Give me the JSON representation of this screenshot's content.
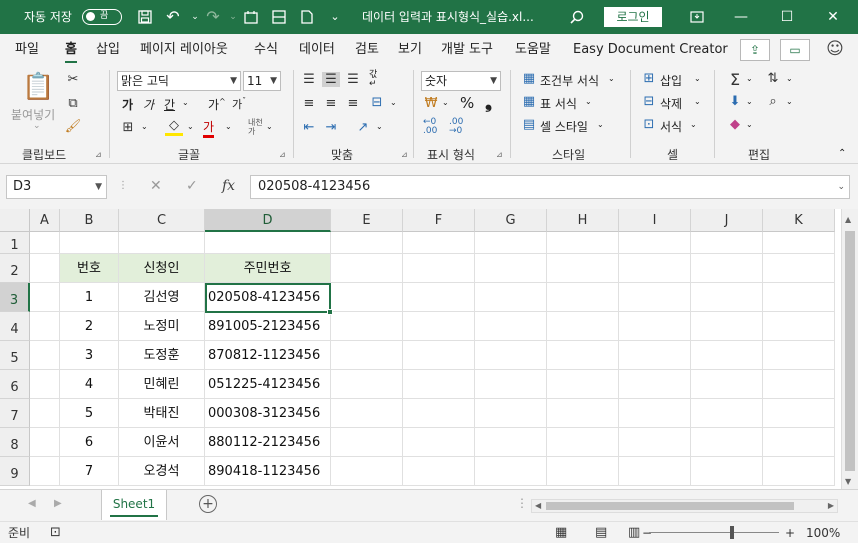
{
  "titlebar": {
    "autosave_label": "자동 저장",
    "autosave_state": "끔",
    "filename": "데이터 입력과 표시형식_실습.xl...",
    "login_label": "로그인"
  },
  "tabs": [
    "파일",
    "홈",
    "삽입",
    "페이지 레이아웃",
    "수식",
    "데이터",
    "검토",
    "보기",
    "개발 도구",
    "도움말",
    "Easy Document Creator"
  ],
  "ribbon": {
    "paste_label": "붙여넣기",
    "clipboard_label": "클립보드",
    "font_name": "맑은 고딕",
    "font_size": "11",
    "font_group_label": "글꼴",
    "align_group_label": "맞춤",
    "number_format": "숫자",
    "number_group_label": "표시 형식",
    "cond_format_label": "조건부 서식",
    "table_format_label": "표 서식",
    "cell_style_label": "셀 스타일",
    "style_group_label": "스타일",
    "insert_label": "삽입",
    "delete_label": "삭제",
    "format_label": "서식",
    "cells_group_label": "셀",
    "edit_group_label": "편집"
  },
  "formula_bar": {
    "name_box": "D3",
    "formula": "020508-4123456"
  },
  "grid": {
    "columns": [
      "A",
      "B",
      "C",
      "D",
      "E",
      "F",
      "G",
      "H",
      "I",
      "J",
      "K"
    ],
    "rows": [
      "1",
      "2",
      "3",
      "4",
      "5",
      "6",
      "7",
      "8",
      "9"
    ],
    "table_headers": [
      "번호",
      "신청인",
      "주민번호"
    ],
    "table_rows": [
      [
        "1",
        "김선영",
        "020508-4123456"
      ],
      [
        "2",
        "노정미",
        "891005-2123456"
      ],
      [
        "3",
        "도정훈",
        "870812-1123456"
      ],
      [
        "4",
        "민혜린",
        "051225-4123456"
      ],
      [
        "5",
        "박태진",
        "000308-3123456"
      ],
      [
        "6",
        "이윤서",
        "880112-2123456"
      ],
      [
        "7",
        "오경석",
        "890418-1123456"
      ]
    ],
    "active_cell": "D3"
  },
  "sheets": [
    "Sheet1"
  ],
  "status": {
    "ready": "준비",
    "zoom": "100%"
  }
}
